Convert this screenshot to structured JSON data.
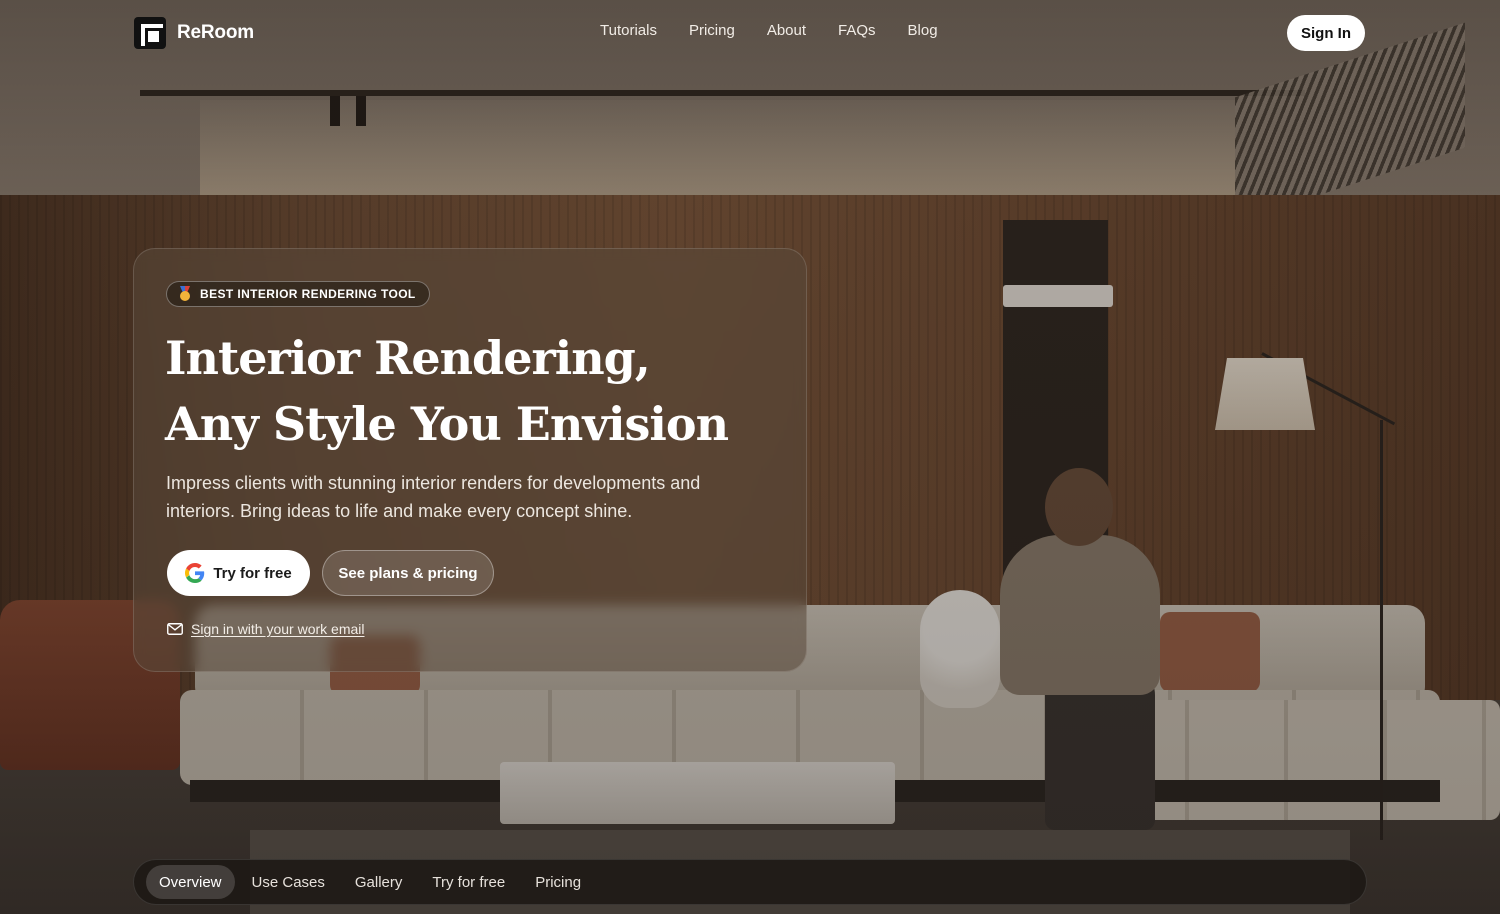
{
  "brand": {
    "name": "ReRoom"
  },
  "nav": {
    "links": [
      "Tutorials",
      "Pricing",
      "About",
      "FAQs",
      "Blog"
    ],
    "sign_in": "Sign In"
  },
  "hero": {
    "badge": "BEST INTERIOR RENDERING TOOL",
    "title_line1": "Interior Rendering,",
    "title_line2": "Any Style You Envision",
    "subtitle": "Impress clients with stunning interior renders for developments and interiors. Bring ideas to life and make every concept shine.",
    "try_button": "Try for free",
    "plans_button": "See plans & pricing",
    "email_link": "Sign in with your work email"
  },
  "section_tabs": {
    "items": [
      "Overview",
      "Use Cases",
      "Gallery",
      "Try for free",
      "Pricing"
    ],
    "active": "Overview"
  },
  "icons": {
    "badge": "medal-icon",
    "try_button": "google-icon",
    "email_link": "mail-icon"
  }
}
